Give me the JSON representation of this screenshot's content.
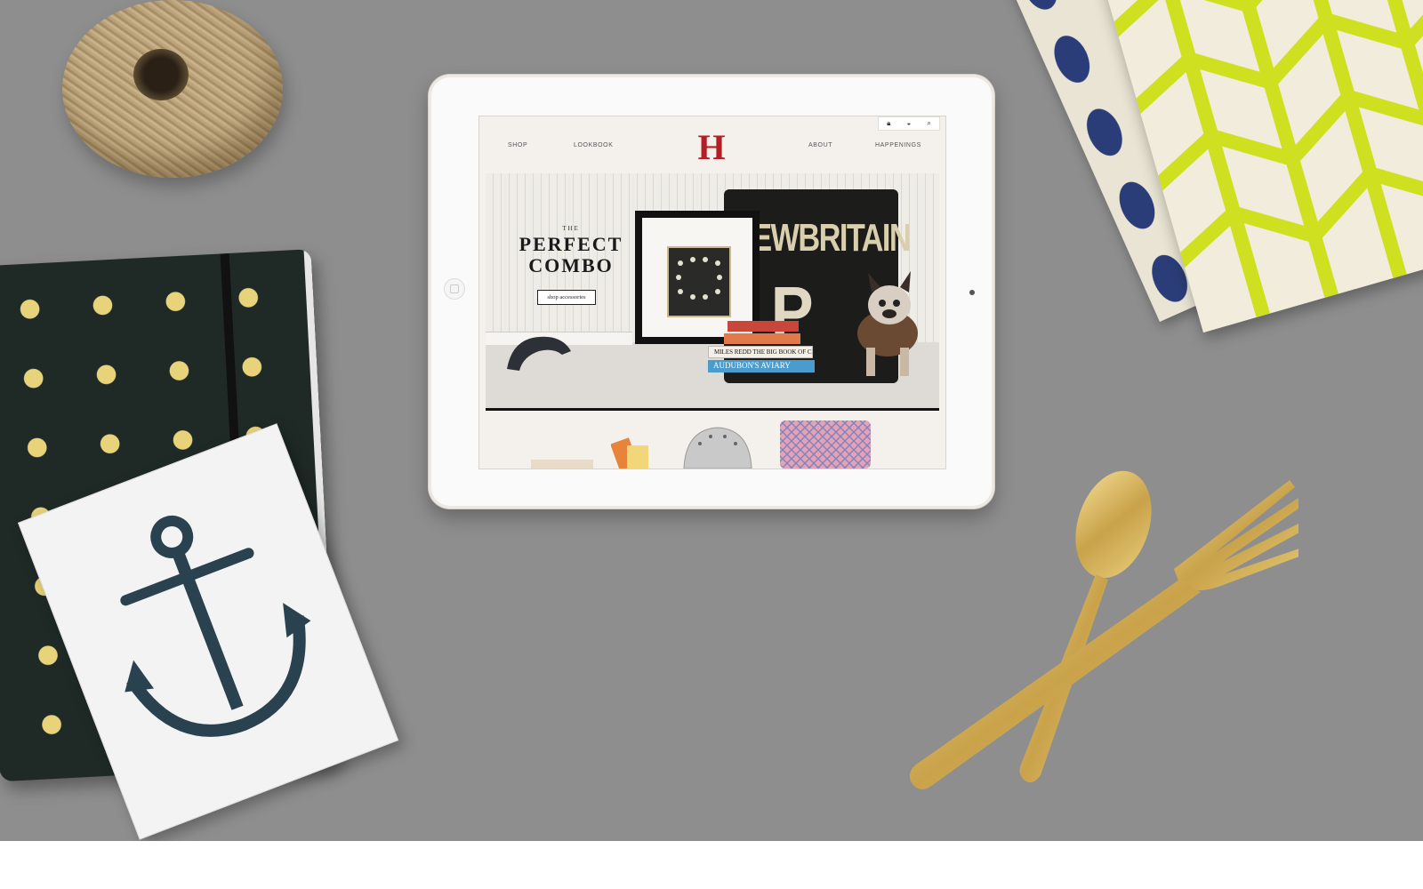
{
  "site": {
    "logo": "H",
    "utility_icons": {
      "account": "lock-icon",
      "cart": "basket-icon",
      "search": "search-icon"
    },
    "nav": {
      "shop": "SHOP",
      "lookbook": "LOOKBOOK",
      "about": "ABOUT",
      "happenings": "HAPPENINGS"
    },
    "hero": {
      "pretitle": "THE",
      "title_line1": "PERFECT",
      "title_line2": "COMBO",
      "cta": "shop accessories",
      "sign_text": "NEWBRITAIN",
      "sign_letter": "P",
      "book_titles": [
        "MILES REDD THE BIG BOOK OF CHIC",
        "AUDUBON'S AVIARY"
      ]
    }
  },
  "colors": {
    "brand_red": "#b31d24",
    "desk_gray": "#8e8e8e",
    "screen_bg": "#f4f1ec"
  }
}
